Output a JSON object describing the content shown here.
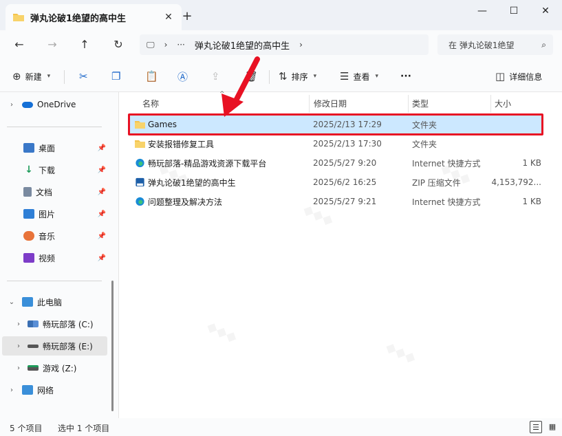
{
  "window": {
    "tab_title": "弹丸论破1绝望的高中生",
    "tab_close": "✕",
    "new_tab": "+",
    "minimize": "—",
    "maximize": "☐",
    "close": "✕"
  },
  "address": {
    "ellipsis": "···",
    "crumb": "弹丸论破1绝望的高中生",
    "search_placeholder": "在 弹丸论破1绝望"
  },
  "toolbar": {
    "new_label": "新建",
    "sort_label": "排序",
    "view_label": "查看",
    "more_label": "···",
    "details_label": "详细信息"
  },
  "sidebar": {
    "onedrive": "OneDrive",
    "quick": [
      {
        "label": "桌面",
        "icon": "desktop-icon",
        "color": "#3a78c8"
      },
      {
        "label": "下载",
        "icon": "download-icon",
        "color": "#1d9b5a"
      },
      {
        "label": "文档",
        "icon": "document-icon",
        "color": "#7a8aa0"
      },
      {
        "label": "图片",
        "icon": "pictures-icon",
        "color": "#2f7fd6"
      },
      {
        "label": "音乐",
        "icon": "music-icon",
        "color": "#e8733a"
      },
      {
        "label": "视频",
        "icon": "video-icon",
        "color": "#7d3cc8"
      }
    ],
    "this_pc": "此电脑",
    "drives": [
      {
        "label": "畅玩部落 (C:)",
        "selected": false
      },
      {
        "label": "畅玩部落 (E:)",
        "selected": true
      },
      {
        "label": "游戏 (Z:)",
        "selected": false
      }
    ],
    "network": "网络"
  },
  "columns": {
    "name": "名称",
    "date": "修改日期",
    "type": "类型",
    "size": "大小"
  },
  "files": [
    {
      "name": "Games",
      "date": "2025/2/13 17:29",
      "type": "文件夹",
      "size": "",
      "icon": "folder-icon",
      "selected": true
    },
    {
      "name": "安装报错修复工具",
      "date": "2025/2/13 17:30",
      "type": "文件夹",
      "size": "",
      "icon": "folder-icon",
      "selected": false
    },
    {
      "name": "畅玩部落-精品游戏资源下载平台",
      "date": "2025/5/27 9:20",
      "type": "Internet 快捷方式",
      "size": "1 KB",
      "icon": "edge-shortcut-icon",
      "selected": false
    },
    {
      "name": "弹丸论破1绝望的高中生",
      "date": "2025/6/2 16:25",
      "type": "ZIP 压缩文件",
      "size": "4,153,792...",
      "icon": "zip-icon",
      "selected": false
    },
    {
      "name": "问题整理及解决方法",
      "date": "2025/5/27 9:21",
      "type": "Internet 快捷方式",
      "size": "1 KB",
      "icon": "edge-shortcut-icon",
      "selected": false
    }
  ],
  "status": {
    "count": "5 个项目",
    "selected": "选中 1 个项目"
  },
  "colors": {
    "accent": "#0078d4",
    "selection": "#cce8ff",
    "highlight": "#e81123",
    "folder": "#f4c34b"
  }
}
